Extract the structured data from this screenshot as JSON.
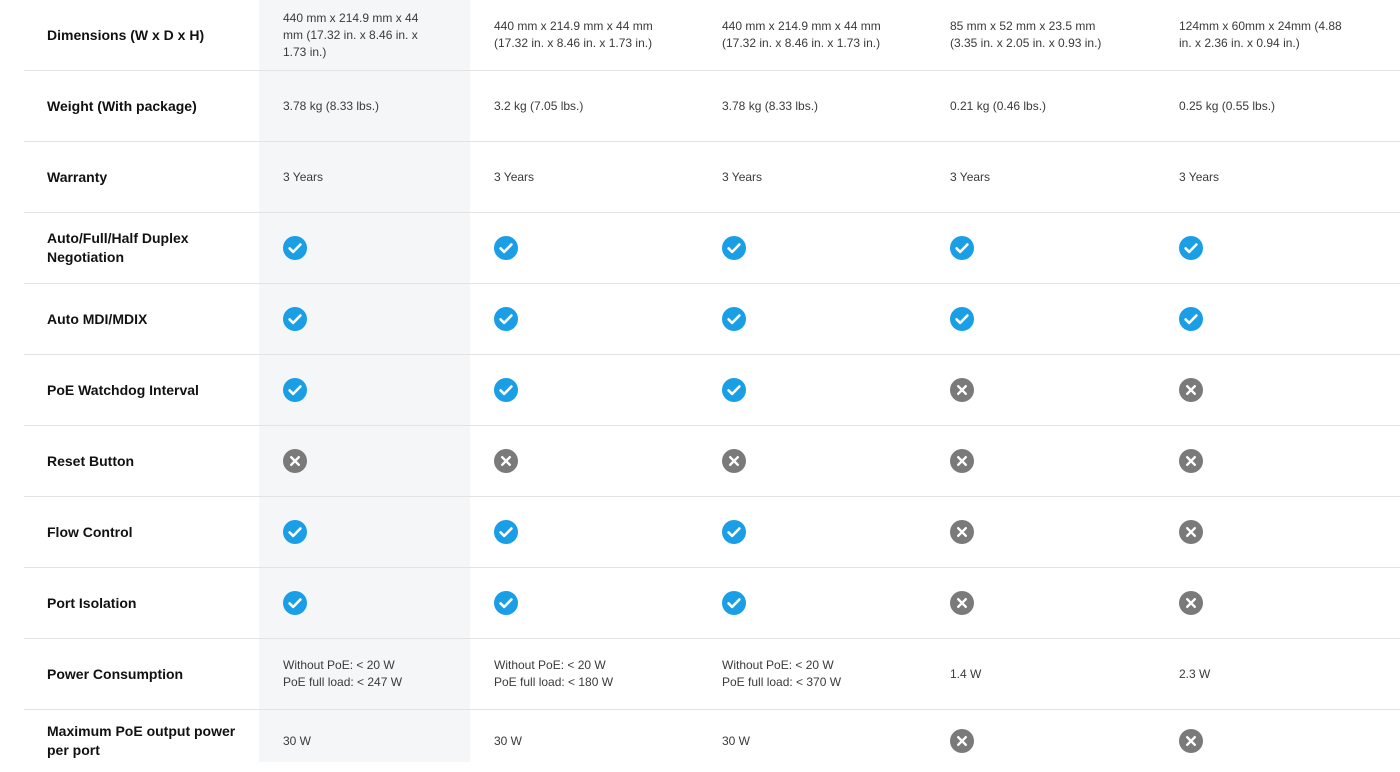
{
  "colors": {
    "check": "#1a9ee6",
    "cross": "#7a7a7a",
    "highlight": "#f5f6f8"
  },
  "rows": [
    {
      "label": "Dimensions (W x D x H)",
      "cells": [
        {
          "text": "440 mm x 214.9 mm x 44\nmm (17.32 in. x 8.46 in. x\n1.73 in.)"
        },
        {
          "text": "440 mm x 214.9 mm x 44 mm\n(17.32 in. x 8.46 in. x 1.73 in.)"
        },
        {
          "text": "440 mm x 214.9 mm x 44 mm\n(17.32 in. x 8.46 in. x 1.73 in.)"
        },
        {
          "text": "85 mm x 52 mm x 23.5 mm\n(3.35 in. x 2.05 in. x 0.93 in.)"
        },
        {
          "text": "124mm x 60mm x 24mm (4.88\nin. x 2.36 in. x 0.94 in.)"
        }
      ]
    },
    {
      "label": "Weight (With package)",
      "cells": [
        {
          "text": "3.78 kg (8.33 lbs.)"
        },
        {
          "text": "3.2 kg (7.05 lbs.)"
        },
        {
          "text": "3.78 kg (8.33 lbs.)"
        },
        {
          "text": "0.21 kg (0.46 lbs.)"
        },
        {
          "text": "0.25 kg (0.55 lbs.)"
        }
      ]
    },
    {
      "label": "Warranty",
      "cells": [
        {
          "text": "3 Years"
        },
        {
          "text": "3 Years"
        },
        {
          "text": "3 Years"
        },
        {
          "text": "3 Years"
        },
        {
          "text": "3 Years"
        }
      ]
    },
    {
      "label": "Auto/Full/Half Duplex Negotiation",
      "cells": [
        {
          "icon": "check-circle-icon"
        },
        {
          "icon": "check-circle-icon"
        },
        {
          "icon": "check-circle-icon"
        },
        {
          "icon": "check-circle-icon"
        },
        {
          "icon": "check-circle-icon"
        }
      ]
    },
    {
      "label": "Auto MDI/MDIX",
      "cells": [
        {
          "icon": "check-circle-icon"
        },
        {
          "icon": "check-circle-icon"
        },
        {
          "icon": "check-circle-icon"
        },
        {
          "icon": "check-circle-icon"
        },
        {
          "icon": "check-circle-icon"
        }
      ]
    },
    {
      "label": "PoE Watchdog Interval",
      "cells": [
        {
          "icon": "check-circle-icon"
        },
        {
          "icon": "check-circle-icon"
        },
        {
          "icon": "check-circle-icon"
        },
        {
          "icon": "cross-circle-icon"
        },
        {
          "icon": "cross-circle-icon"
        }
      ]
    },
    {
      "label": "Reset Button",
      "cells": [
        {
          "icon": "cross-circle-icon"
        },
        {
          "icon": "cross-circle-icon"
        },
        {
          "icon": "cross-circle-icon"
        },
        {
          "icon": "cross-circle-icon"
        },
        {
          "icon": "cross-circle-icon"
        }
      ]
    },
    {
      "label": "Flow Control",
      "cells": [
        {
          "icon": "check-circle-icon"
        },
        {
          "icon": "check-circle-icon"
        },
        {
          "icon": "check-circle-icon"
        },
        {
          "icon": "cross-circle-icon"
        },
        {
          "icon": "cross-circle-icon"
        }
      ]
    },
    {
      "label": "Port Isolation",
      "cells": [
        {
          "icon": "check-circle-icon"
        },
        {
          "icon": "check-circle-icon"
        },
        {
          "icon": "check-circle-icon"
        },
        {
          "icon": "cross-circle-icon"
        },
        {
          "icon": "cross-circle-icon"
        }
      ]
    },
    {
      "label": "Power Consumption",
      "cells": [
        {
          "text": "Without PoE: < 20 W\nPoE full load: < 247 W"
        },
        {
          "text": "Without PoE: < 20 W\nPoE full load: < 180 W"
        },
        {
          "text": "Without PoE: < 20 W\nPoE full load: < 370 W"
        },
        {
          "text": "1.4 W"
        },
        {
          "text": "2.3 W"
        }
      ]
    },
    {
      "label": "Maximum PoE output power per port",
      "cells": [
        {
          "text": "30 W"
        },
        {
          "text": "30 W"
        },
        {
          "text": "30 W"
        },
        {
          "icon": "cross-circle-icon"
        },
        {
          "icon": "cross-circle-icon"
        }
      ]
    }
  ]
}
